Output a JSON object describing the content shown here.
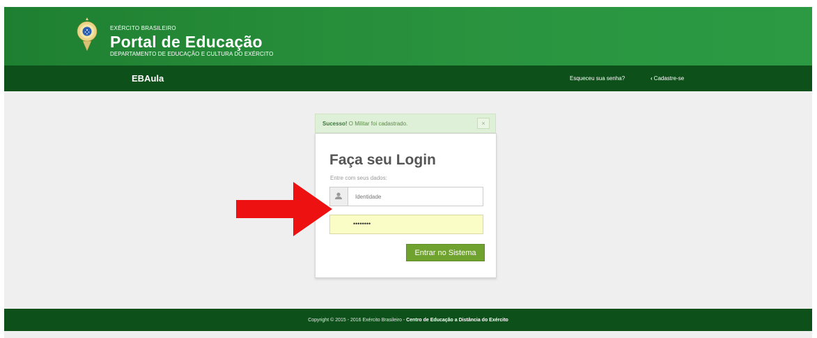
{
  "header": {
    "org_small": "EXÉRCITO BRASILEIRO",
    "title": "Portal de Educação",
    "subtitle": "DEPARTAMENTO DE EDUCAÇÃO E CULTURA DO EXÉRCITO"
  },
  "navbar": {
    "brand": "EBAula",
    "forgot_password": "Esqueceu sua senha?",
    "register": "Cadastre-se"
  },
  "alert": {
    "strong": "Sucesso!",
    "message": " O Militar foi cadastrado.",
    "close": "×"
  },
  "login": {
    "title": "Faça seu Login",
    "subtitle": "Entre com seus dados:",
    "identity_placeholder": "Identidade",
    "password_value": "••••••••",
    "submit_label": "Entrar no Sistema"
  },
  "footer": {
    "copyright": "Copyright © 2015 - 2016 Exército Brasileiro - ",
    "institution": "Centro de Educação a Distância do Exército"
  },
  "colors": {
    "header_green": "#268c39",
    "nav_dark_green": "#0d5019",
    "button_green": "#6fa22f",
    "alert_bg": "#dff0d8",
    "password_autofill": "#fafdc5",
    "arrow_red": "#ee1111"
  },
  "icons": {
    "emblem": "army-emblem-icon",
    "user": "user-icon",
    "register_chevron": "chevron-left-icon",
    "arrow": "red-arrow-icon"
  }
}
